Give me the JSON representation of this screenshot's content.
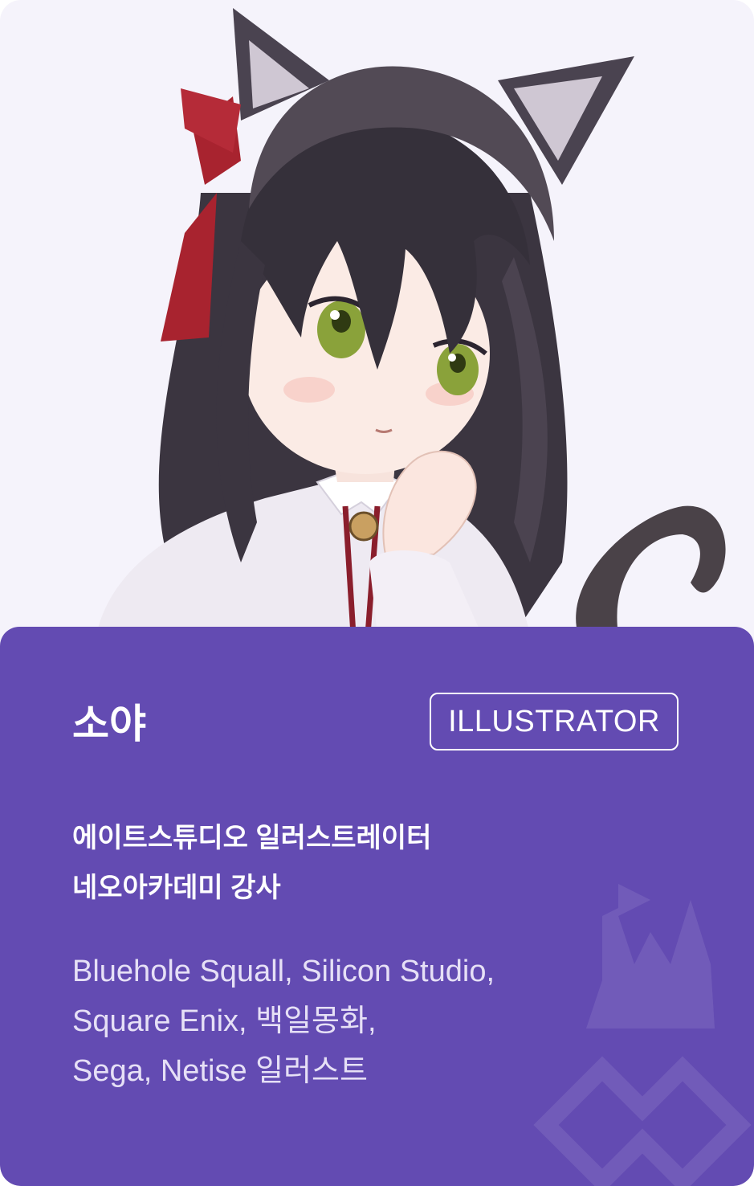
{
  "profile": {
    "name": "소야",
    "role_badge": "ILLUSTRATOR",
    "titles": [
      "에이트스튜디오 일러스트레이터",
      "네오아카데미 강사"
    ],
    "works": [
      "Bluehole Squall, Silicon Studio,",
      "Square Enix, 백일몽화,",
      "Sega, Netise 일러스트"
    ]
  },
  "colors": {
    "panel": "#634bb2",
    "background": "#f5f3fb",
    "text_primary": "#ffffff",
    "text_secondary": "#e6e0f6"
  },
  "icons": [
    "character-illustration",
    "castle-emblem-icon"
  ]
}
